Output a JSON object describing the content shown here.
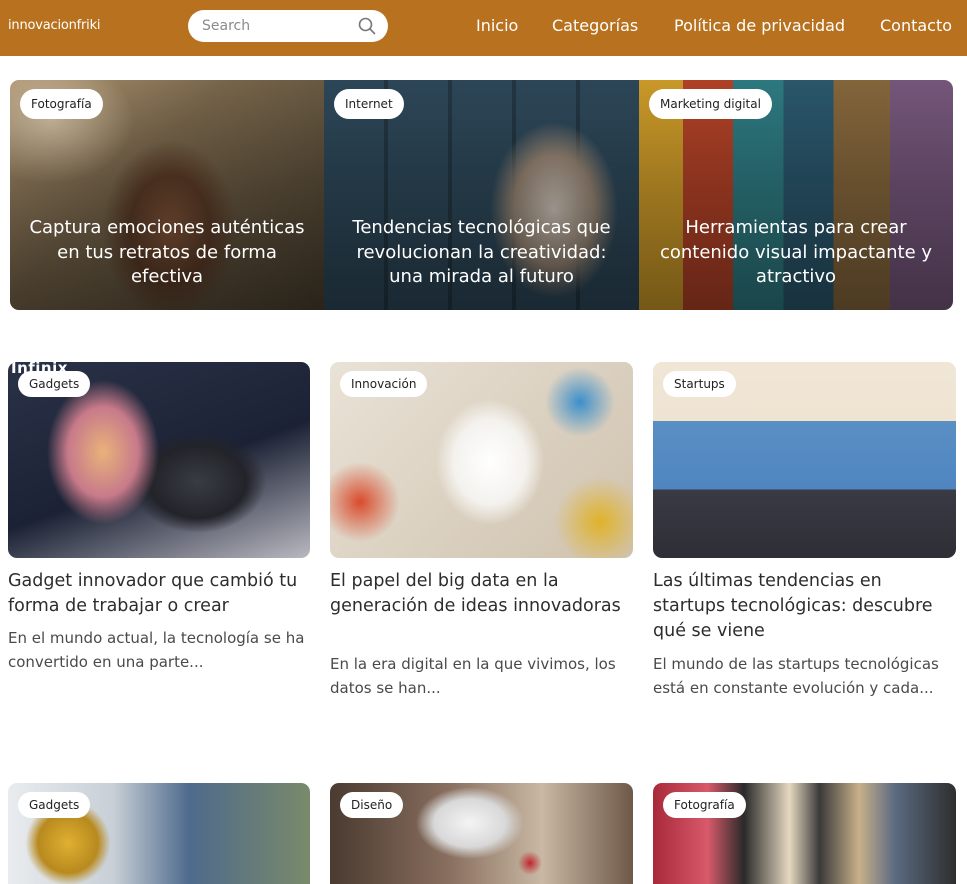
{
  "header": {
    "logo": "innovacionfriki",
    "search_placeholder": "Search",
    "nav": [
      "Inicio",
      "Categorías",
      "Política de privacidad",
      "Contacto"
    ]
  },
  "hero": [
    {
      "category": "Fotografía",
      "title": "Captura emociones auténticas en tus retratos de forma efectiva"
    },
    {
      "category": "Internet",
      "title": "Tendencias tecnológicas que revolucionan la creatividad: una mirada al futuro"
    },
    {
      "category": "Marketing digital",
      "title": "Herramientas para crear contenido visual impactante y atractivo"
    }
  ],
  "posts": [
    {
      "category": "Gadgets",
      "title": "Gadget innovador que cambió tu forma de trabajar o crear",
      "excerpt": "En el mundo actual, la tecnología se ha convertido en una parte...",
      "watermark": "Infinix"
    },
    {
      "category": "Innovación",
      "title": "El papel del big data en la generación de ideas innovadoras",
      "excerpt": "En la era digital en la que vivimos, los datos se han..."
    },
    {
      "category": "Startups",
      "title": "Las últimas tendencias en startups tecnológicas: descubre qué se viene",
      "excerpt": "El mundo de las startups tecnológicas está en constante evolución y cada..."
    },
    {
      "category": "Gadgets"
    },
    {
      "category": "Diseño"
    },
    {
      "category": "Fotografía"
    }
  ],
  "colors": {
    "header": "#b8721f",
    "text": "#2d2d2d"
  }
}
